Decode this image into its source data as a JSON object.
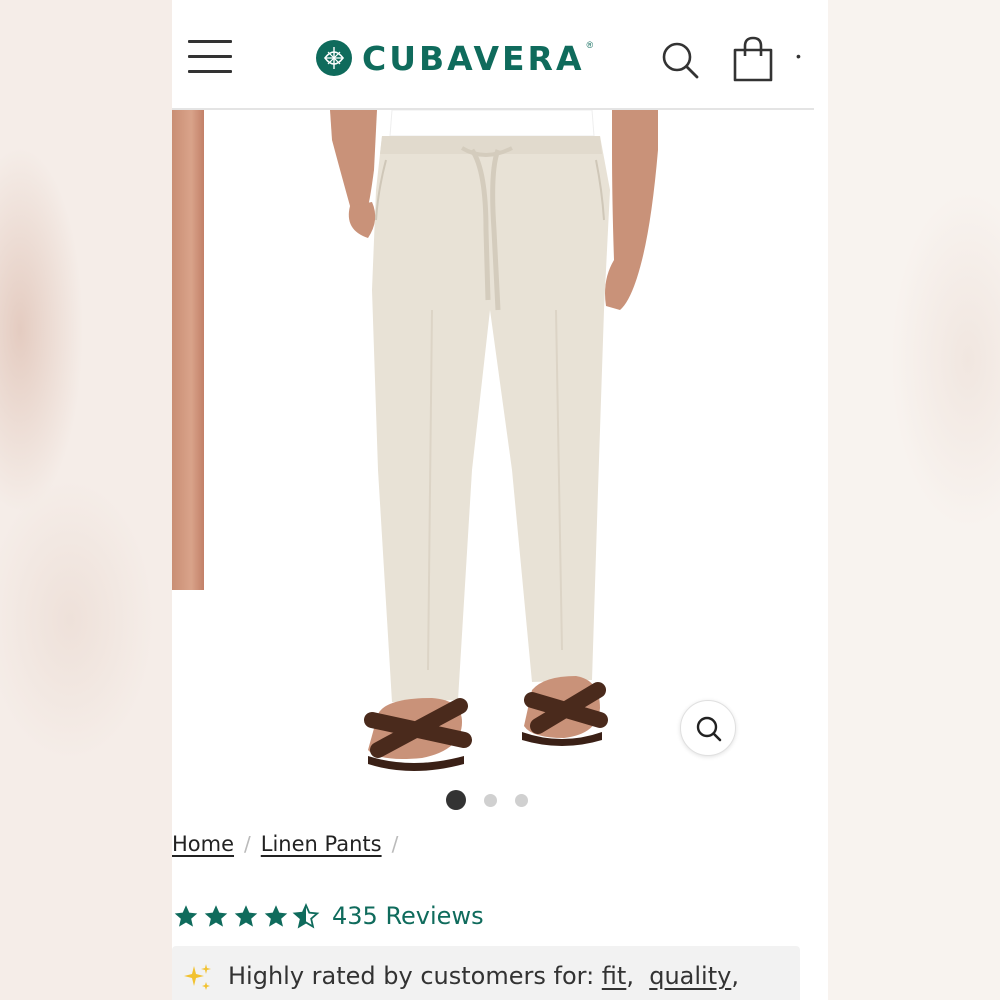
{
  "header": {
    "brand_name": "CUBAVERA",
    "brand_mark": "®",
    "icons": {
      "menu": "hamburger-menu-icon",
      "search": "search-icon",
      "bag": "shopping-bag-icon"
    },
    "brand_color": "#0f6b5c"
  },
  "gallery": {
    "image": "beige-linen-drawstring-pants",
    "slide_count": 3,
    "active_slide": 1,
    "zoom_icon": "zoom-icon"
  },
  "breadcrumb": {
    "items": [
      "Home",
      "Linen Pants"
    ],
    "separator": "/"
  },
  "rating": {
    "stars": 4.5,
    "reviews_label": "435 Reviews"
  },
  "highlights": {
    "prefix": "Highly rated by customers for:",
    "items": [
      "fit",
      "quality"
    ],
    "icon": "sparkles-icon"
  }
}
